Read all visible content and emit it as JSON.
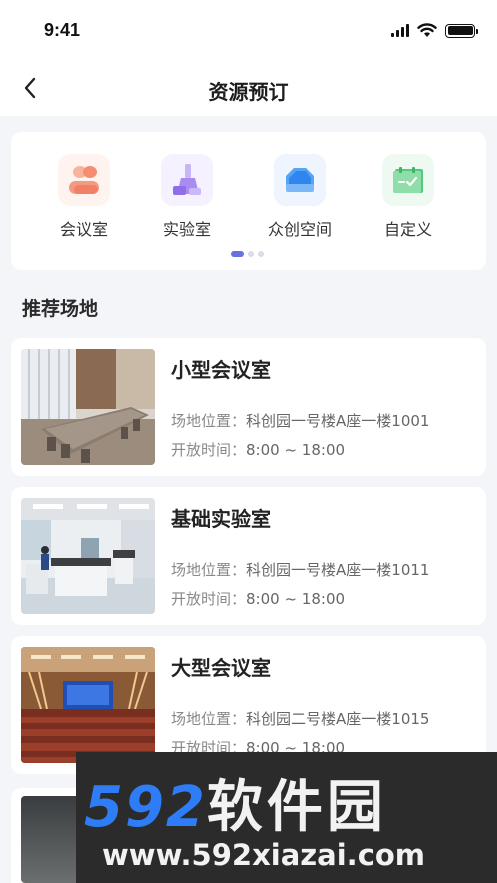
{
  "status_bar": {
    "time": "9:41"
  },
  "nav": {
    "title": "资源预订"
  },
  "categories": [
    {
      "label": "会议室",
      "icon": "meeting-room-icon"
    },
    {
      "label": "实验室",
      "icon": "laboratory-icon"
    },
    {
      "label": "众创空间",
      "icon": "maker-space-icon"
    },
    {
      "label": "自定义",
      "icon": "custom-icon"
    }
  ],
  "carousel": {
    "pages": 3,
    "active": 0
  },
  "section": {
    "title": "推荐场地"
  },
  "venues": [
    {
      "name": "小型会议室",
      "location_label": "场地位置：",
      "location": "科创园一号楼A座一楼1001",
      "hours_label": "开放时间：",
      "hours": "8:00 ~ 18:00"
    },
    {
      "name": "基础实验室",
      "location_label": "场地位置：",
      "location": "科创园一号楼A座一楼1011",
      "hours_label": "开放时间：",
      "hours": "8:00 ~ 18:00"
    },
    {
      "name": "大型会议室",
      "location_label": "场地位置：",
      "location": "科创园二号楼A座一楼1015",
      "hours_label": "开放时间：",
      "hours": "8:00 ~ 18:00"
    }
  ],
  "watermark": {
    "brand_number": "592",
    "brand_text": "软件园",
    "url": "www.592xiazai.com"
  }
}
